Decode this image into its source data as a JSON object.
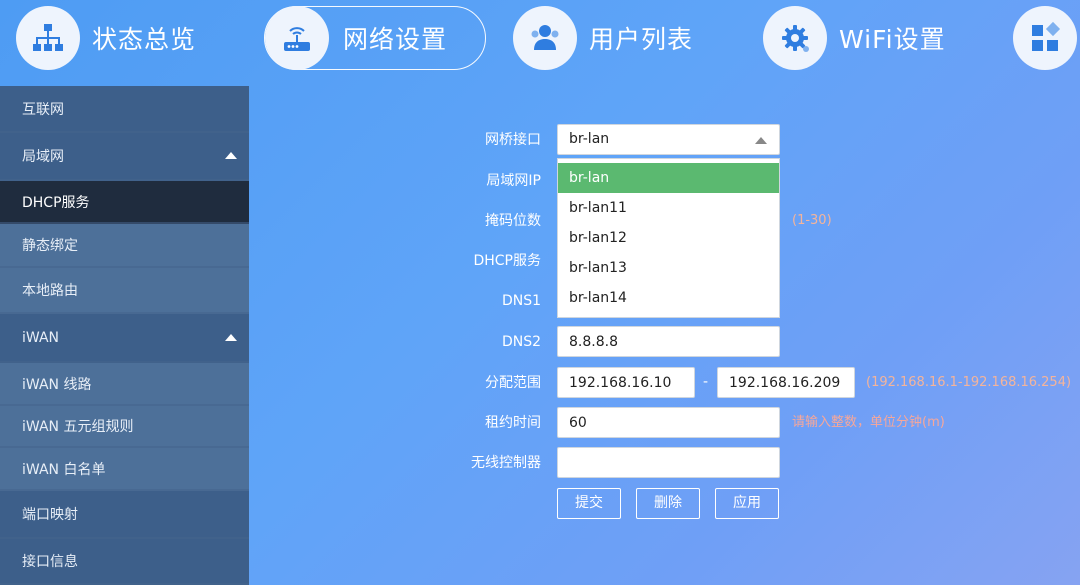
{
  "topnav": {
    "items": [
      {
        "label": "状态总览",
        "icon": "network-topology-icon"
      },
      {
        "label": "网络设置",
        "icon": "router-icon",
        "active": true
      },
      {
        "label": "用户列表",
        "icon": "users-icon"
      },
      {
        "label": "WiFi设置",
        "icon": "gear-icon"
      },
      {
        "label": "",
        "icon": "app-grid-icon"
      }
    ]
  },
  "sidebar": {
    "items": [
      {
        "label": "互联网"
      },
      {
        "label": "局域网"
      },
      {
        "label": "DHCP服务"
      },
      {
        "label": "静态绑定"
      },
      {
        "label": "本地路由"
      },
      {
        "label": "iWAN"
      },
      {
        "label": "iWAN 线路"
      },
      {
        "label": "iWAN 五元组规则"
      },
      {
        "label": "iWAN 白名单"
      },
      {
        "label": "端口映射"
      },
      {
        "label": "接口信息"
      }
    ]
  },
  "form": {
    "bridge_label": "网桥接口",
    "bridge_value": "br-lan",
    "bridge_options": [
      "br-lan",
      "br-lan11",
      "br-lan12",
      "br-lan13",
      "br-lan14"
    ],
    "lan_ip_label": "局域网IP",
    "mask_label": "掩码位数",
    "mask_hint": "(1-30)",
    "dhcp_label": "DHCP服务",
    "dns1_label": "DNS1",
    "dns2_label": "DNS2",
    "dns2_value": "8.8.8.8",
    "range_label": "分配范围",
    "range_start": "192.168.16.10",
    "range_sep": "-",
    "range_end": "192.168.16.209",
    "range_hint": "(192.168.16.1-192.168.16.254)",
    "lease_label": "租约时间",
    "lease_value": "60",
    "lease_hint": "请输入整数，单位分钟(m)",
    "wlc_label": "无线控制器",
    "wlc_value": ""
  },
  "buttons": {
    "submit": "提交",
    "delete": "删除",
    "apply": "应用"
  },
  "colors": {
    "selected_option": "#5bb970",
    "sidebar_active": "#1f2c3e",
    "hint": "#f4b49b"
  }
}
